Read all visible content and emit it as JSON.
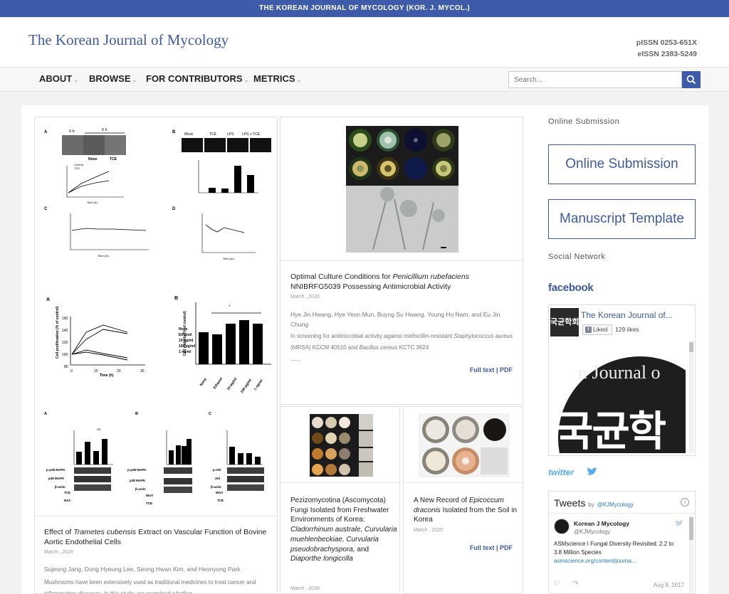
{
  "topbar": {
    "text": "THE KOREAN JOURNAL OF MYCOLOGY (KOR. J. MYCOL.)"
  },
  "header": {
    "title": "The Korean Journal of Mycology",
    "pissn": "pISSN 0253-651X",
    "eissn": "eISSN 2383-5249"
  },
  "nav": {
    "items": [
      {
        "label": "ABOUT"
      },
      {
        "label": "BROWSE"
      },
      {
        "label": "FOR CONTRIBUTORS"
      },
      {
        "label": "METRICS"
      }
    ],
    "search_placeholder": "Search..."
  },
  "articles": {
    "a1": {
      "title_pre": "Effect of ",
      "title_em": "Trametes cubensis",
      "title_post": " Extract on Vascular Function of Bovine Aortic Endothelial Cells",
      "date": "March , 2020",
      "authors": "Sujeong Jang, Dong Hyeung Lee, Seong Hwan Kim, and Heonyong Park",
      "abstract": "Mushrooms have been extensively used as traditional medicines to treat cancer and inflammatory diseases. In this study, we examined whether"
    },
    "a2": {
      "title_pre": "Optimal Culture Conditions for ",
      "title_em": "Penicillium rubefaciens",
      "title_post": " NNIBRFG5039 Possessing Antimicrobial Activity",
      "date": "March , 2020",
      "authors": "Hye Jin Hwang, Hye Yeon Mun, Buyng Su Hwang, Young Ho Nam, and Eu Jin Chung",
      "abstract_pre": "In screening for antimicrobial activity against methicillin-resistant ",
      "abstract_em1": "Staphylococcus aureus",
      "abstract_mid": " (MRSA) KCCM 40510 and ",
      "abstract_em2": "Bacillus cereus",
      "abstract_post": " KCTC 3624",
      "ellipsis": "......",
      "fulltext": "Full text",
      "sep": "|",
      "pdf": "PDF"
    },
    "a3": {
      "title_plain": "Pezizomycotina (Ascomycota) Fungi Isolated from Freshwater Environments of Korea: ",
      "title_em1": "Cladorrhinum australe, Curvularia muehlenbeckiae, Curvularia pseudobrachyspora,",
      "title_and": " and ",
      "title_em2": "Diaporthe longicolla",
      "date": "March , 2020"
    },
    "a4": {
      "title_pre": "A New Record of ",
      "title_em": "Epicoccum draconis",
      "title_post": " Isolated from the Soil in Korea",
      "date": "March , 2020",
      "fulltext": "Full text",
      "sep": "|",
      "pdf": "PDF"
    }
  },
  "figure1": {
    "panelA_left": "0 h",
    "panelA_right": "6 h",
    "panelA_none": "None",
    "panelA_tce": "TCE",
    "panelB_labels": [
      "Mock",
      "TCE",
      "LPS",
      "LPS + TCE"
    ],
    "legend_control": "Control",
    "legend_tce": "TCE",
    "time_h": "Time (h)",
    "time_m": "Time (m)",
    "letters": [
      "A",
      "B",
      "C",
      "D"
    ]
  },
  "figure2": {
    "legend": [
      "None",
      "Ethanol",
      "10 pg/ml",
      "100 pg/ml",
      "1 ng/ml"
    ],
    "ylabel_left": "Cell proliferation (% of control)",
    "ylabel_right": "Cell viability (% of control)",
    "xlabel": "Time (h)",
    "yticks": [
      "160",
      "140",
      "120",
      "100",
      "80"
    ],
    "xticks": [
      "0",
      "10",
      "20",
      "30"
    ],
    "bar_cats": [
      "None",
      "Ethanol",
      "10 pg/ml",
      "100 pg/ml",
      "1 ng/ml"
    ],
    "letters": [
      "A",
      "B"
    ],
    "star": "*"
  },
  "figure3": {
    "letters": [
      "A",
      "B",
      "C"
    ],
    "blots_a": [
      "p-p38 MAPK",
      "p38 MAPK",
      "β-actin"
    ],
    "blots_c": [
      "p-Akt",
      "Akt",
      "β-actin"
    ],
    "row_tce": "TCE",
    "row_nac": "NAC",
    "row_wort": "Wort",
    "ns": "NS"
  },
  "sidebar": {
    "online_submission_heading": "Online Submission",
    "online_submission_button": "Online Submission",
    "manuscript_button": "Manuscript Template",
    "social_heading": "Social Network",
    "facebook_logo": "facebook",
    "fb_page_name": "The Korean Journal of...",
    "fb_liked": "Liked",
    "fb_likes": "129 likes",
    "fb_banner_text1": "n Journal o",
    "fb_banner_text2": "국균학",
    "fb_thumb_text": "국균학회",
    "twitter_logo": "twitter",
    "tweets_label": "Tweets",
    "tweets_by": "by",
    "tweets_handle": "@KJMycology",
    "tweet_author": "Korean J Mycology",
    "tweet_author_handle": "@KJMycology",
    "tweet_text": "ASMscience I Fungal Diversity Revisited: 2.2 to 3.8 Million Species",
    "tweet_link": "asmscience.org/content/journa...",
    "tweet_date": "Aug 8, 2017"
  }
}
